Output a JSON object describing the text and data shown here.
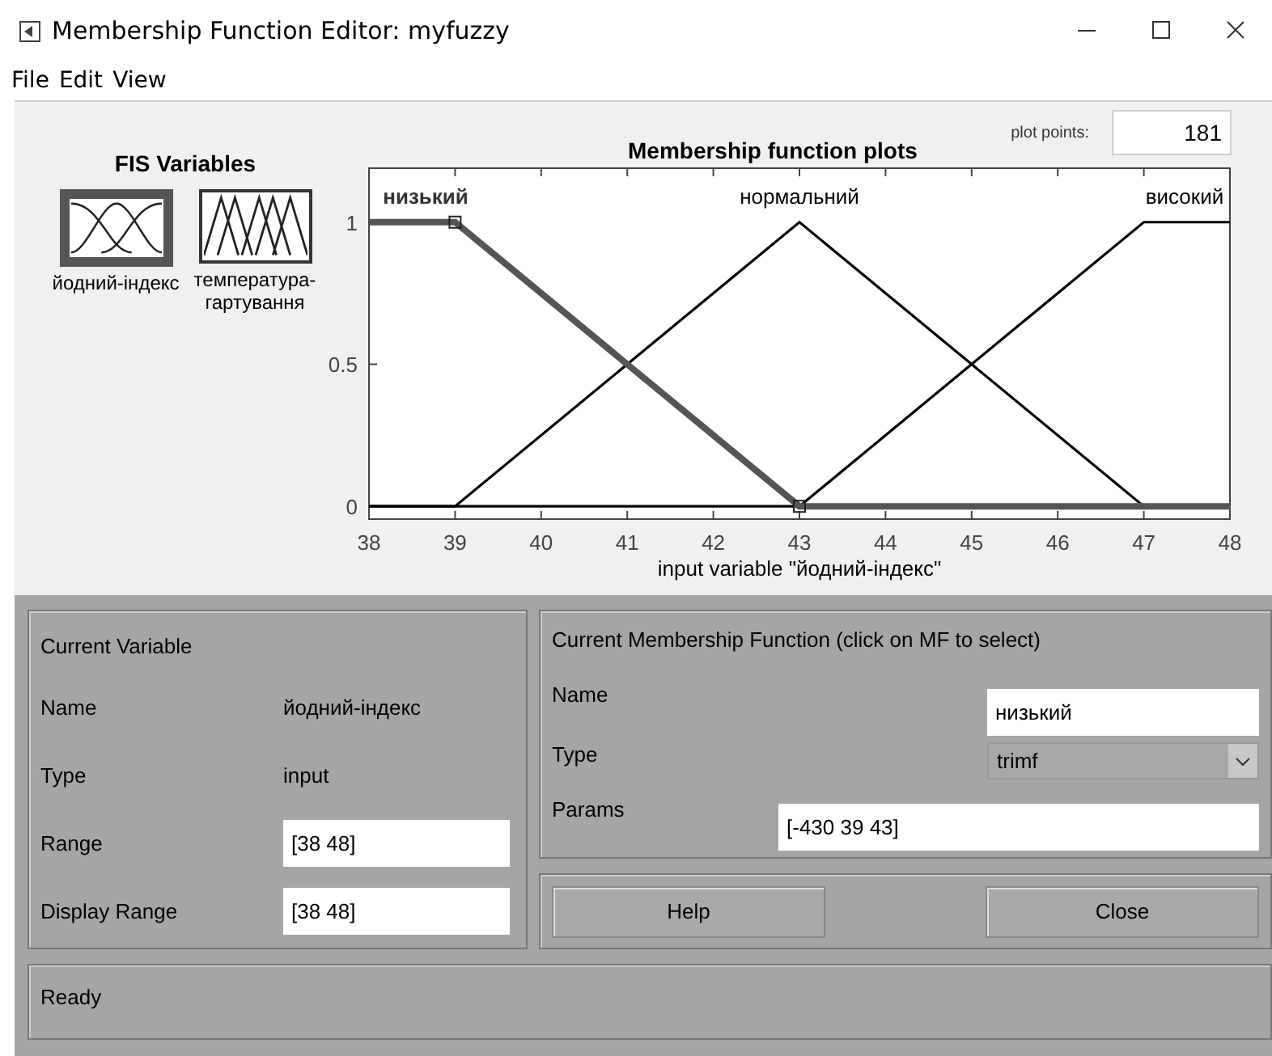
{
  "window": {
    "title": "Membership Function Editor: myfuzzy"
  },
  "menu": [
    "File",
    "Edit",
    "View"
  ],
  "fis_variables": {
    "title": "FIS Variables",
    "items": [
      {
        "label": "йодний-індекс",
        "kind": "input",
        "selected": true
      },
      {
        "label": "температура-гартування",
        "kind": "output",
        "selected": false
      }
    ]
  },
  "plot": {
    "title": "Membership function plots",
    "plot_points_label": "plot points:",
    "plot_points": "181",
    "chart_data": {
      "type": "line",
      "xlabel": "input variable \"йодний-індекс\"",
      "x": [
        38,
        39,
        43,
        47,
        48
      ],
      "xlim": [
        38,
        48
      ],
      "ylim": [
        -0.045,
        1.19
      ],
      "xticks": [
        38,
        39,
        40,
        41,
        42,
        43,
        44,
        45,
        46,
        47,
        48
      ],
      "yticks": [
        0,
        0.5,
        1
      ],
      "series": [
        {
          "color": "#555555",
          "values": [
            1,
            1,
            0,
            0,
            0
          ]
        },
        {
          "color": "#000000",
          "values": [
            0,
            0,
            1,
            0,
            0
          ]
        },
        {
          "color": "#000000",
          "values": [
            0,
            0,
            0,
            1,
            1
          ]
        }
      ]
    },
    "mf_labels": [
      {
        "label": "низький",
        "selected": true
      },
      {
        "label": "нормальний",
        "selected": false
      },
      {
        "label": "високий",
        "selected": false
      }
    ]
  },
  "current_variable": {
    "title": "Current Variable",
    "name_label": "Name",
    "name": "йодний-індекс",
    "type_label": "Type",
    "type": "input",
    "range_label": "Range",
    "range": "[38 48]",
    "display_range_label": "Display Range",
    "display_range": "[38 48]"
  },
  "current_mf": {
    "title": "Current Membership Function (click on MF to select)",
    "name_label": "Name",
    "name": "низький",
    "type_label": "Type",
    "type": "trimf",
    "params_label": "Params",
    "params": "[-430 39 43]"
  },
  "buttons": [
    "Help",
    "Close"
  ],
  "status": "Ready"
}
